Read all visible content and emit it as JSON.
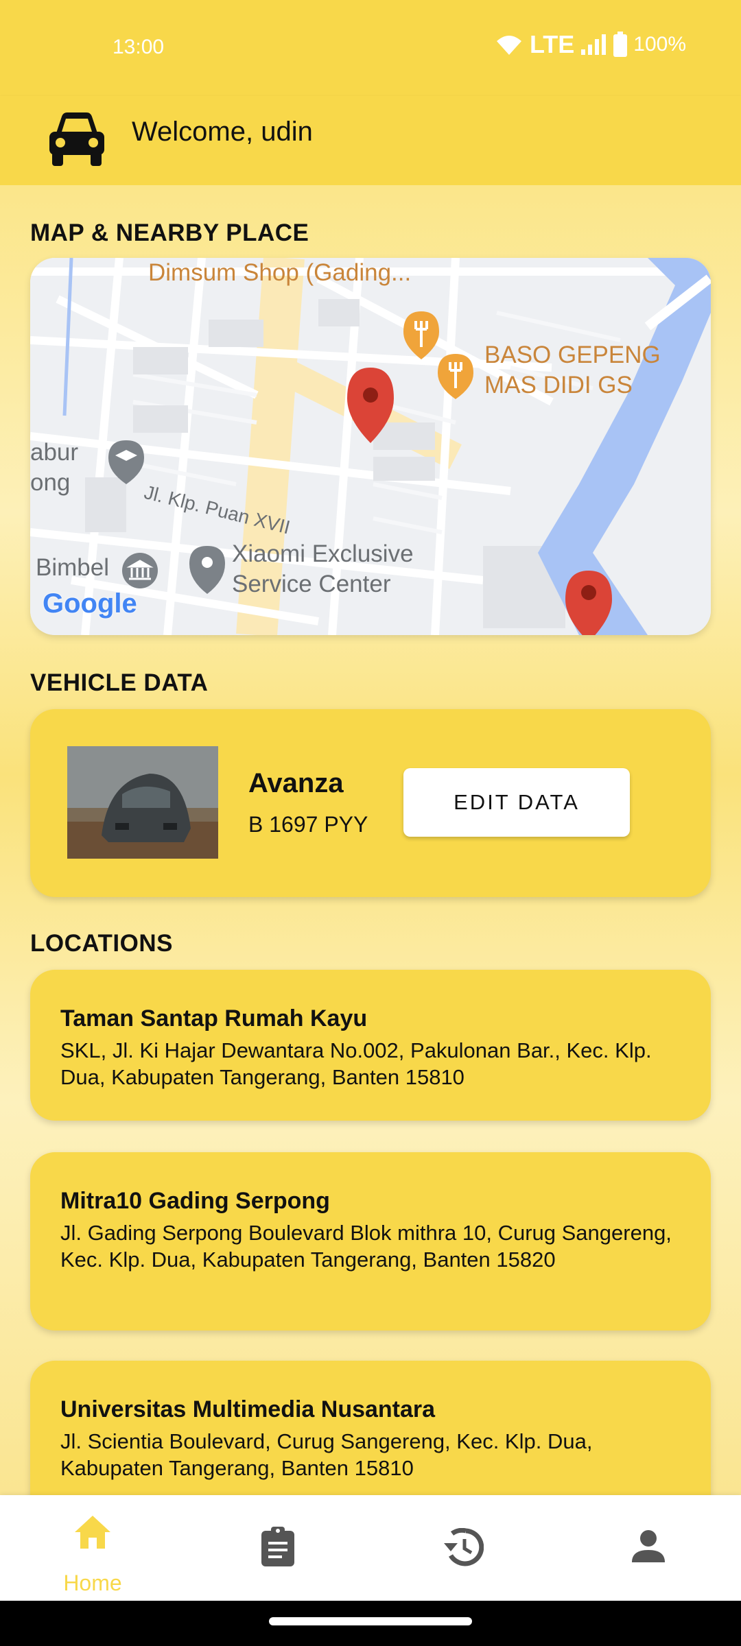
{
  "status": {
    "time": "13:00",
    "network": "LTE",
    "battery": "100%"
  },
  "appbar": {
    "title": "Welcome, udin",
    "icon": "car-icon"
  },
  "sections": {
    "map": "MAP & NEARBY PLACE",
    "vehicle": "VEHICLE DATA",
    "locations": "LOCATIONS"
  },
  "map": {
    "labels": {
      "dimsum": "Dimsum Shop (Gading...",
      "baso_1": "BASO GEPENG",
      "baso_2": "MAS DIDI GS",
      "street": "Jl. Klp. Puan XVII",
      "school_1": "abur",
      "school_2": "ong",
      "xiaomi_1": "Xiaomi Exclusive",
      "xiaomi_2": "Service Center",
      "bimbel": "Bimbel",
      "google": "Google"
    }
  },
  "vehicle": {
    "name": "Avanza",
    "plate": "B 1697 PYY",
    "edit_label": "EDIT DATA"
  },
  "locations": [
    {
      "name": "Taman Santap Rumah Kayu",
      "address": "SKL, Jl. Ki Hajar Dewantara No.002, Pakulonan Bar., Kec. Klp. Dua, Kabupaten Tangerang, Banten 15810"
    },
    {
      "name": "Mitra10 Gading Serpong",
      "address": "Jl. Gading Serpong Boulevard Blok mithra 10, Curug Sangereng, Kec. Klp. Dua, Kabupaten Tangerang, Banten 15820"
    },
    {
      "name": "Universitas Multimedia Nusantara",
      "address": "Jl. Scientia Boulevard, Curug Sangereng, Kec. Klp. Dua, Kabupaten Tangerang, Banten 15810"
    }
  ],
  "nav": {
    "home": "Home",
    "active": "home"
  },
  "colors": {
    "accent": "#f8d84a",
    "pin": "#db4437"
  }
}
